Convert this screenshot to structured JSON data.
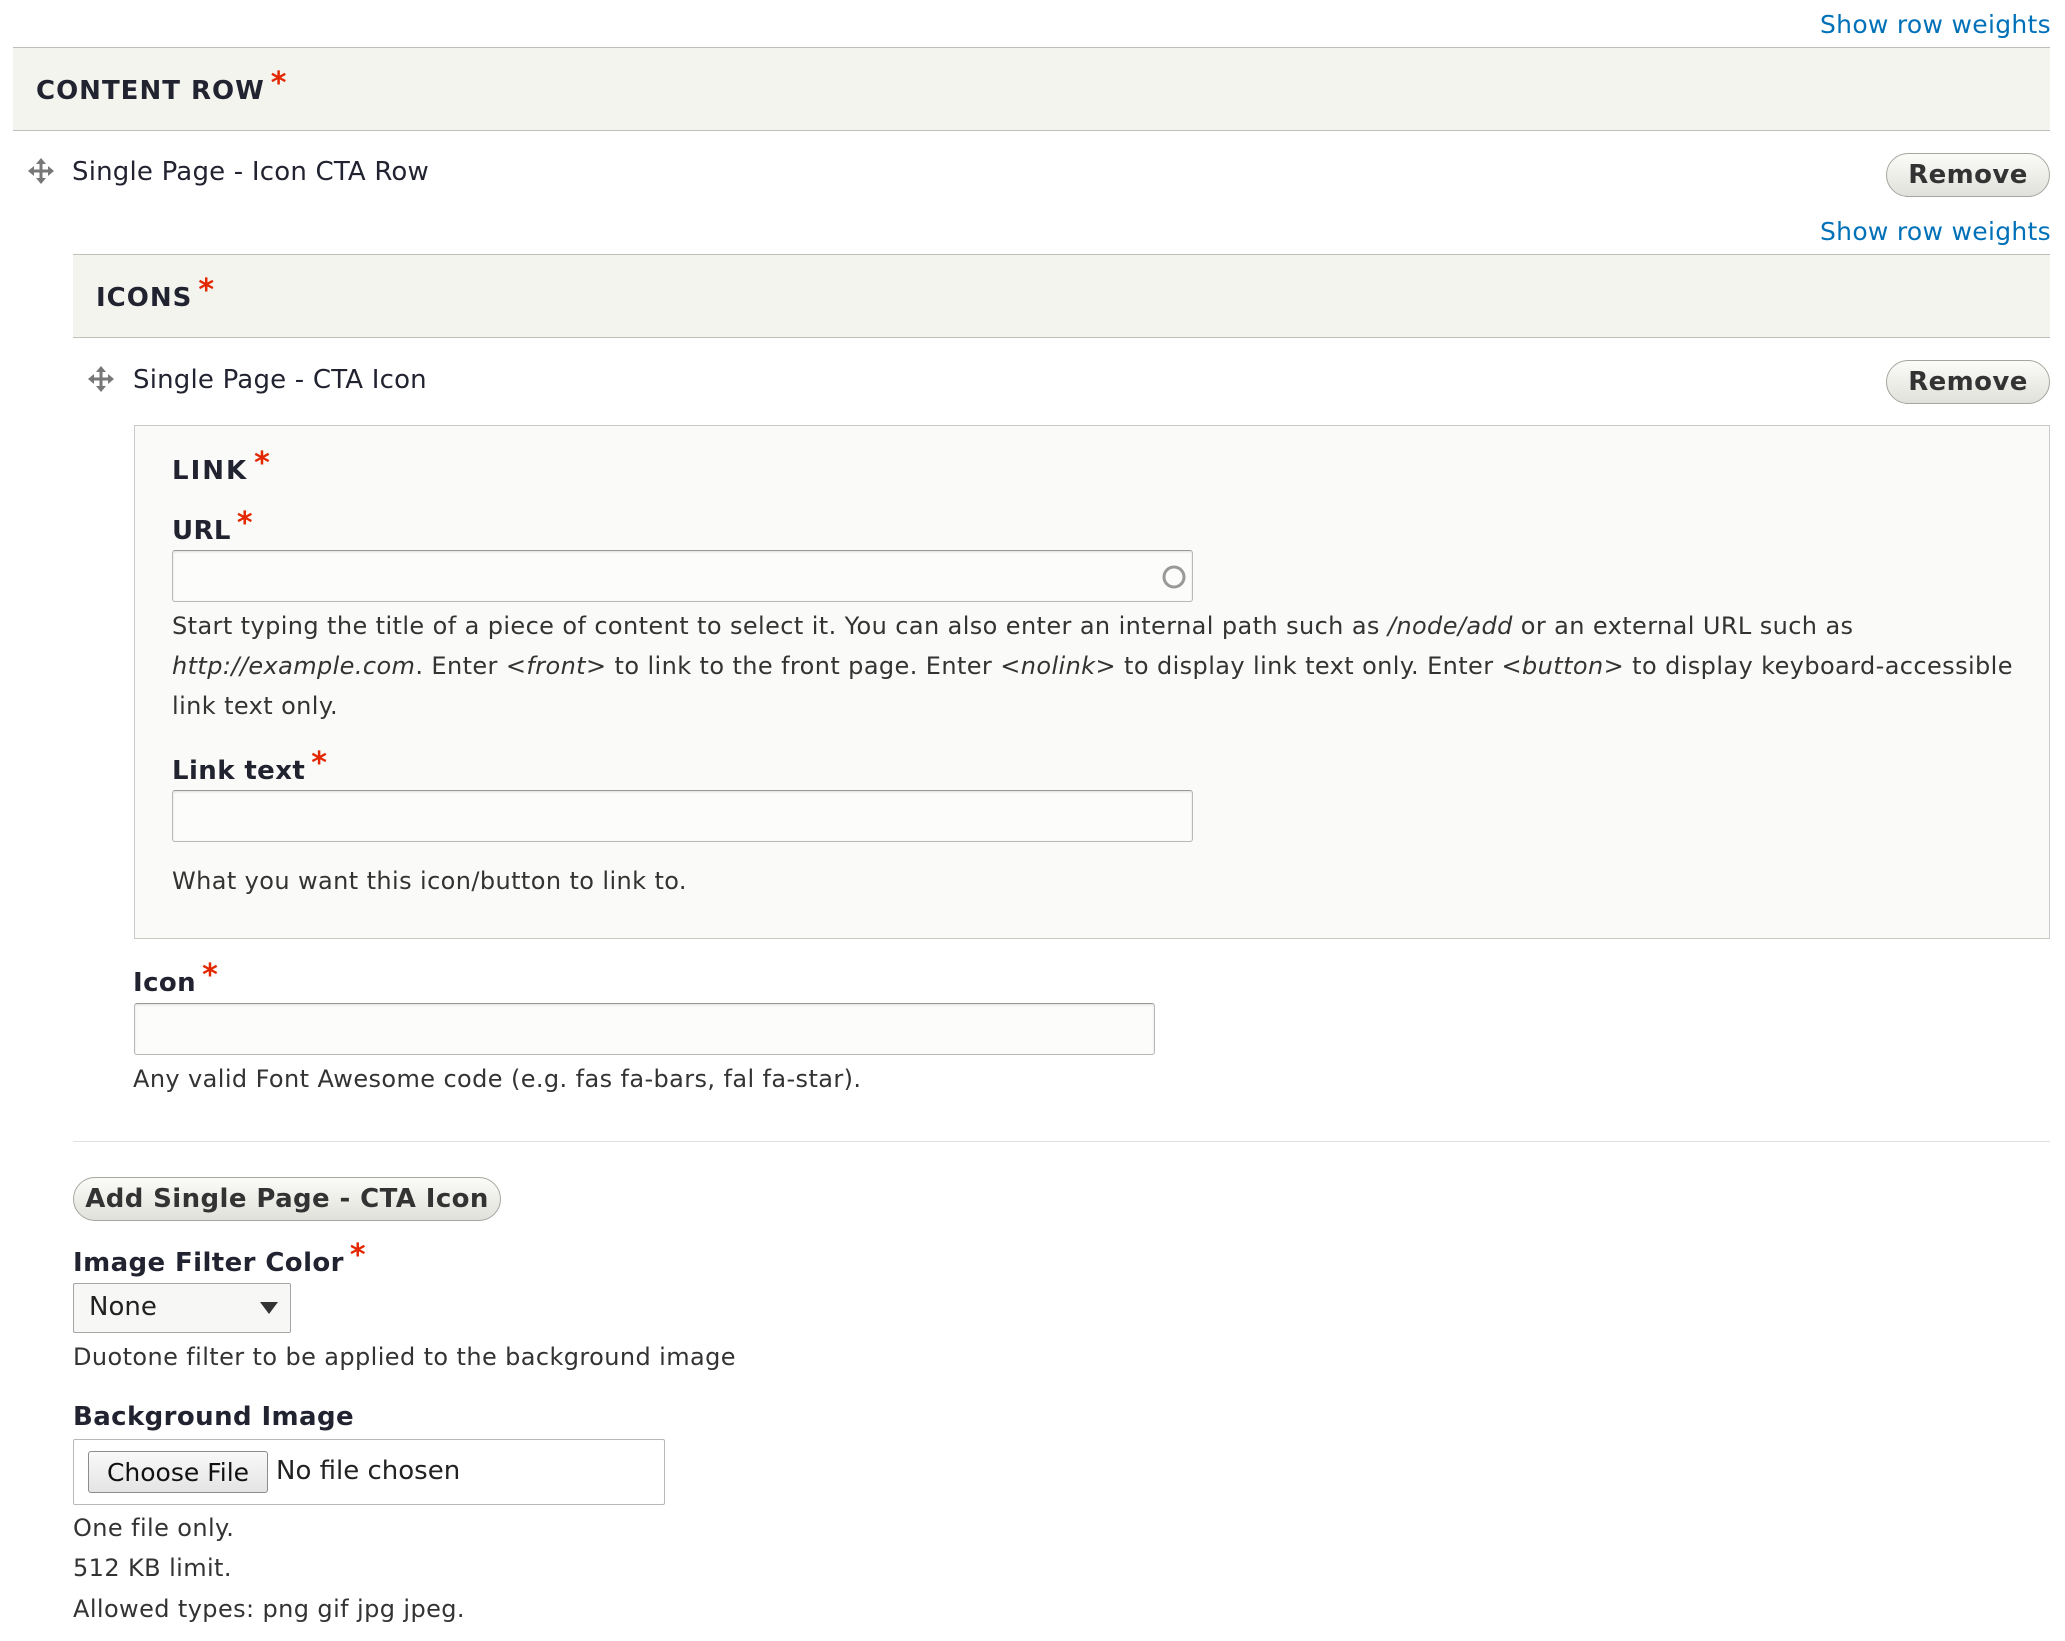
{
  "show_row_weights": "Show row weights",
  "content_row": {
    "title": "CONTENT ROW",
    "required_mark": "*",
    "item_label": "Single Page - Icon CTA Row",
    "remove_label": "Remove"
  },
  "icons": {
    "title": "ICONS",
    "required_mark": "*",
    "item_label": "Single Page - CTA Icon",
    "remove_label": "Remove"
  },
  "link": {
    "legend": "LINK",
    "required_mark": "*",
    "url_label": "URL",
    "url_value": "",
    "url_desc_1": "Start typing the title of a piece of content to select it. You can also enter an internal path such as ",
    "url_desc_em_1": "/node/add",
    "url_desc_2": " or an external URL such as ",
    "url_desc_em_2": "http://example.com",
    "url_desc_3": ". Enter ",
    "url_desc_em_3": "<front>",
    "url_desc_4": " to link to the front page. Enter ",
    "url_desc_em_4": "<nolink>",
    "url_desc_5": " to display link text only. Enter ",
    "url_desc_em_5": "<button>",
    "url_desc_6": " to display keyboard-accessible link text only.",
    "link_text_label": "Link text",
    "link_text_value": "",
    "link_text_desc": "What you want this icon/button to link to."
  },
  "icon_field": {
    "label": "Icon",
    "value": "",
    "desc": "Any valid Font Awesome code (e.g. fas fa-bars, fal fa-star)."
  },
  "add_button": "Add Single Page - CTA Icon",
  "image_filter": {
    "label": "Image Filter Color",
    "selected": "None",
    "desc": "Duotone filter to be applied to the background image"
  },
  "background_image": {
    "label": "Background Image",
    "choose_file": "Choose File",
    "no_file": "No file chosen",
    "help": [
      "One file only.",
      "512 KB limit.",
      "Allowed types: png gif jpg jpeg."
    ]
  },
  "colors": {
    "link": "#0071b8",
    "required": "#e32700",
    "section_bg": "#f3f4ee"
  }
}
